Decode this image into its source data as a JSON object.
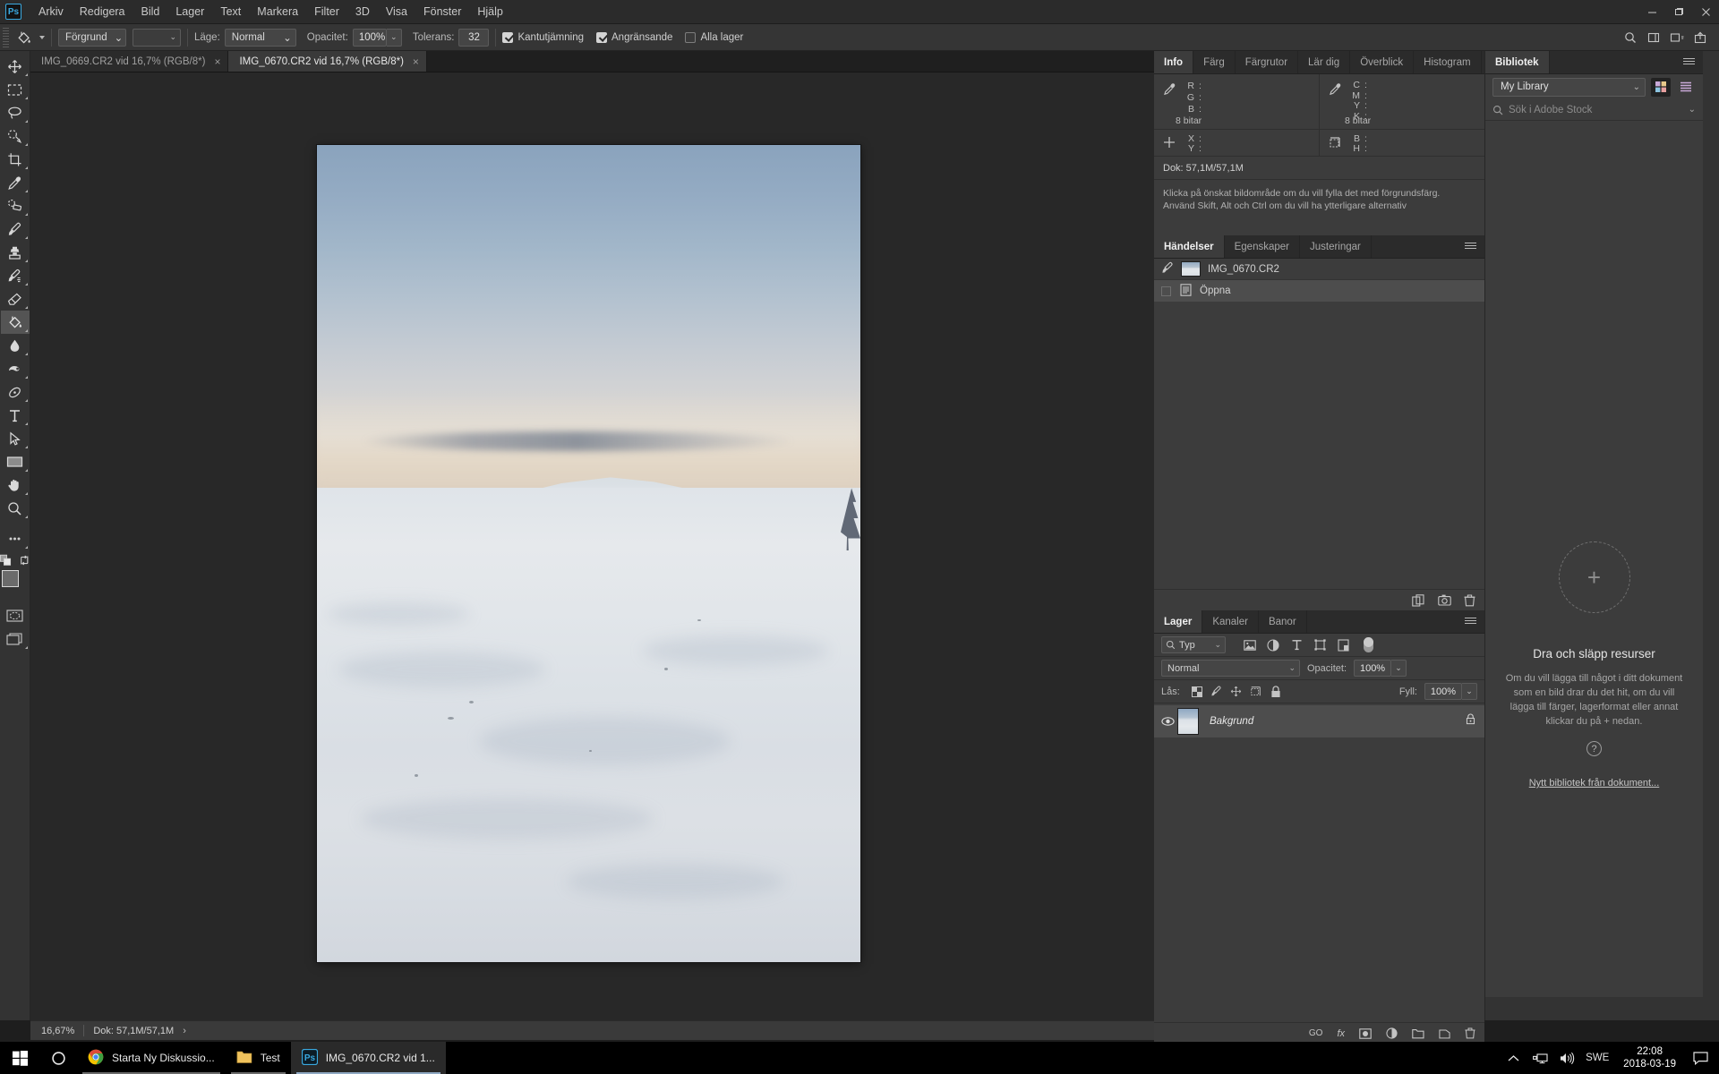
{
  "menubar": {
    "app_icon": "photoshop-logo",
    "items": [
      "Arkiv",
      "Redigera",
      "Bild",
      "Lager",
      "Text",
      "Markera",
      "Filter",
      "3D",
      "Visa",
      "Fönster",
      "Hjälp"
    ],
    "window_controls": [
      "minimize",
      "restore",
      "close"
    ]
  },
  "options_bar": {
    "tool_icon": "paint-bucket-icon",
    "fill_source": "Förgrund",
    "mode_label": "Läge:",
    "mode_value": "Normal",
    "opacity_label": "Opacitet:",
    "opacity_value": "100%",
    "tolerance_label": "Tolerans:",
    "tolerance_value": "32",
    "antialias_label": "Kantutjämning",
    "antialias_checked": true,
    "contiguous_label": "Angränsande",
    "contiguous_checked": true,
    "all_layers_label": "Alla lager",
    "all_layers_checked": false,
    "right_icons": [
      "search-icon",
      "workspace-icon",
      "workspace-switcher-icon",
      "share-icon"
    ]
  },
  "toolbar": {
    "tools": [
      {
        "name": "move-tool",
        "active": false
      },
      {
        "name": "rectangular-marquee-tool",
        "active": false
      },
      {
        "name": "lasso-tool",
        "active": false
      },
      {
        "name": "quick-selection-tool",
        "active": false
      },
      {
        "name": "crop-tool",
        "active": false
      },
      {
        "name": "eyedropper-tool",
        "active": false
      },
      {
        "name": "spot-healing-brush-tool",
        "active": false
      },
      {
        "name": "brush-tool",
        "active": false
      },
      {
        "name": "clone-stamp-tool",
        "active": false
      },
      {
        "name": "history-brush-tool",
        "active": false
      },
      {
        "name": "eraser-tool",
        "active": false
      },
      {
        "name": "paint-bucket-tool",
        "active": true
      },
      {
        "name": "blur-tool",
        "active": false
      },
      {
        "name": "dodge-tool",
        "active": false
      },
      {
        "name": "pen-tool",
        "active": false
      },
      {
        "name": "type-tool",
        "active": false
      },
      {
        "name": "path-selection-tool",
        "active": false
      },
      {
        "name": "rectangle-tool",
        "active": false
      },
      {
        "name": "hand-tool",
        "active": false
      },
      {
        "name": "zoom-tool",
        "active": false
      },
      {
        "name": "edit-toolbar-tool",
        "active": false
      }
    ],
    "foreground_color": "#6b6b6b",
    "background_color": "#ffffff"
  },
  "document_tabs": [
    {
      "label": "IMG_0669.CR2 vid 16,7% (RGB/8*)",
      "active": false,
      "close": "×"
    },
    {
      "label": "IMG_0670.CR2 vid 16,7% (RGB/8*)",
      "active": true,
      "close": "×"
    }
  ],
  "status_bar": {
    "zoom": "16,67%",
    "doc_size": "Dok: 57,1M/57,1M",
    "arrow": "›"
  },
  "info_panel": {
    "tabs": [
      "Info",
      "Färg",
      "Färgrutor",
      "Lär dig",
      "Överblick",
      "Histogram"
    ],
    "active_tab": "Info",
    "rgb": {
      "icon": "eyedropper-icon",
      "rows": [
        "R",
        "G",
        "B"
      ],
      "values": [
        "",
        "",
        ""
      ],
      "bit_depth": "8 bitar"
    },
    "cmyk": {
      "icon": "eyedropper-icon",
      "rows": [
        "C",
        "M",
        "Y",
        "K"
      ],
      "values": [
        "",
        "",
        "",
        ""
      ],
      "bit_depth": "8 bitar"
    },
    "position": {
      "icon": "crosshair-icon",
      "rows": [
        "X",
        "Y"
      ],
      "values": [
        "",
        ""
      ]
    },
    "dimensions": {
      "icon": "marquee-icon",
      "rows": [
        "B",
        "H"
      ],
      "values": [
        "",
        ""
      ]
    },
    "doc_size": "Dok: 57,1M/57,1M",
    "hint": "Klicka på önskat bildområde om du vill fylla det med förgrundsfärg. Använd Skift, Alt och Ctrl om du vill ha ytterligare alternativ"
  },
  "history_panel": {
    "tabs": [
      "Händelser",
      "Egenskaper",
      "Justeringar"
    ],
    "active_tab": "Händelser",
    "snapshot": {
      "label": "IMG_0670.CR2",
      "icon": "history-brush-icon"
    },
    "states": [
      {
        "label": "Öppna",
        "icon": "open-document-icon",
        "selected": true
      }
    ],
    "footer_icons": [
      "new-document-from-state-icon",
      "new-snapshot-icon",
      "delete-icon"
    ]
  },
  "layers_panel": {
    "tabs": [
      "Lager",
      "Kanaler",
      "Banor"
    ],
    "active_tab": "Lager",
    "filter_placeholder": "Typ",
    "filter_icons": [
      "image-filter-icon",
      "adjustment-filter-icon",
      "type-filter-icon",
      "shape-filter-icon",
      "smartobject-filter-icon"
    ],
    "filter_toggle": "filter-enable-toggle",
    "blend_mode": "Normal",
    "opacity_label": "Opacitet:",
    "opacity_value": "100%",
    "lock_label": "Lås:",
    "lock_icons": [
      "lock-transparency-icon",
      "lock-image-icon",
      "lock-position-icon",
      "lock-artboard-icon",
      "lock-all-icon"
    ],
    "fill_label": "Fyll:",
    "fill_value": "100%",
    "layers": [
      {
        "name": "Bakgrund",
        "visible": true,
        "locked": true,
        "thumb": "photo-thumbnail"
      }
    ],
    "footer_icons": [
      "link-layers-icon",
      "layer-style-icon",
      "layer-mask-icon",
      "adjustment-layer-icon",
      "new-group-icon",
      "new-layer-icon",
      "delete-layer-icon"
    ],
    "footer_labels": [
      "GO",
      "fx"
    ]
  },
  "library_panel": {
    "tabs": [
      "Bibliotek"
    ],
    "active_tab": "Bibliotek",
    "library_select": "My Library",
    "view_icons": [
      "grid-view-icon",
      "list-view-icon"
    ],
    "search_placeholder": "Sök i Adobe Stock",
    "search_icon": "search-icon",
    "drop_title": "Dra och släpp resurser",
    "drop_desc": "Om du vill lägga till något i ditt dokument som en bild drar du det hit, om du vill lägga till färger, lagerformat eller annat klickar du på + nedan.",
    "help_icon": "help-icon",
    "link": "Nytt bibliotek från dokument...",
    "plus_icon": "plus-icon",
    "footer_icons": [
      "add-content-icon",
      "upload-icon",
      "visibility-icon",
      "delete-icon"
    ]
  },
  "taskbar": {
    "start_icon": "windows-start-icon",
    "search_icon": "cortana-search-icon",
    "buttons": [
      {
        "label": "Starta Ny Diskussio...",
        "icon": "chrome-icon",
        "running": true,
        "active": false
      },
      {
        "label": "Test",
        "icon": "folder-icon",
        "running": true,
        "active": false
      },
      {
        "label": "IMG_0670.CR2 vid 1...",
        "icon": "photoshop-icon",
        "running": true,
        "active": true
      }
    ],
    "tray": {
      "chevron": "show-hidden-icons",
      "network_icon": "network-icon",
      "volume_icon": "volume-icon",
      "language": "SWE",
      "time": "22:08",
      "date": "2018-03-19",
      "notification_icon": "action-center-icon"
    }
  },
  "colors": {
    "accent": "#3aa9e0",
    "panel_bg": "#3c3c3c",
    "chrome_bg": "#333333",
    "canvas_bg": "#282828"
  }
}
